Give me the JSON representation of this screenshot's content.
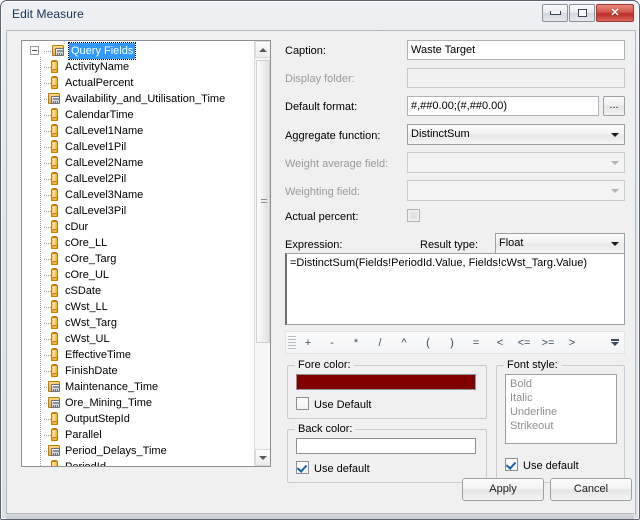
{
  "window": {
    "title": "Edit Measure",
    "controls": {
      "minimize": "minimize",
      "restore": "restore",
      "close": "✕"
    }
  },
  "tree": {
    "root": {
      "label": "Query Fields",
      "icon": "calculated-folder-icon",
      "selected": true,
      "expanded": true
    },
    "items": [
      {
        "label": "ActivityName",
        "icon": "field-icon"
      },
      {
        "label": "ActualPercent",
        "icon": "field-icon"
      },
      {
        "label": "Availability_and_Utilisation_Time",
        "icon": "calculated-folder-icon"
      },
      {
        "label": "CalendarTime",
        "icon": "field-icon"
      },
      {
        "label": "CalLevel1Name",
        "icon": "field-icon"
      },
      {
        "label": "CalLevel1Pil",
        "icon": "field-icon"
      },
      {
        "label": "CalLevel2Name",
        "icon": "field-icon"
      },
      {
        "label": "CalLevel2Pil",
        "icon": "field-icon"
      },
      {
        "label": "CalLevel3Name",
        "icon": "field-icon"
      },
      {
        "label": "CalLevel3Pil",
        "icon": "field-icon"
      },
      {
        "label": "cDur",
        "icon": "field-icon"
      },
      {
        "label": "cOre_LL",
        "icon": "field-icon"
      },
      {
        "label": "cOre_Targ",
        "icon": "field-icon"
      },
      {
        "label": "cOre_UL",
        "icon": "field-icon"
      },
      {
        "label": "cSDate",
        "icon": "field-icon"
      },
      {
        "label": "cWst_LL",
        "icon": "field-icon"
      },
      {
        "label": "cWst_Targ",
        "icon": "field-icon"
      },
      {
        "label": "cWst_UL",
        "icon": "field-icon"
      },
      {
        "label": "EffectiveTime",
        "icon": "field-icon"
      },
      {
        "label": "FinishDate",
        "icon": "field-icon"
      },
      {
        "label": "Maintenance_Time",
        "icon": "calculated-folder-icon"
      },
      {
        "label": "Ore_Mining_Time",
        "icon": "calculated-folder-icon"
      },
      {
        "label": "OutputStepId",
        "icon": "field-icon"
      },
      {
        "label": "Parallel",
        "icon": "field-icon"
      },
      {
        "label": "Period_Delays_Time",
        "icon": "calculated-folder-icon"
      },
      {
        "label": "PeriodId",
        "icon": "field-icon"
      }
    ],
    "scrollbar": {
      "up": "scroll-up-icon",
      "down": "scroll-down-icon"
    }
  },
  "form": {
    "caption": {
      "label": "Caption:",
      "value": "Waste Target",
      "placeholder": ""
    },
    "display_folder": {
      "label": "Display folder:",
      "value": "",
      "placeholder": "",
      "disabled": true
    },
    "default_format": {
      "label": "Default format:",
      "value": "#,##0.00;(#,##0.00)",
      "placeholder": "",
      "browse": "..."
    },
    "aggregate_function": {
      "label": "Aggregate function:",
      "value": "DistinctSum"
    },
    "weight_average_field": {
      "label": "Weight average field:",
      "value": "",
      "disabled": true
    },
    "weighting_field": {
      "label": "Weighting field:",
      "value": "",
      "disabled": true
    },
    "actual_percent": {
      "label": "Actual percent:",
      "checked": false,
      "disabled": true
    },
    "expression": {
      "label": "Expression:",
      "value": "=DistinctSum(Fields!PeriodId.Value, Fields!cWst_Targ.Value)"
    },
    "result_type": {
      "label": "Result type:",
      "value": "Float"
    },
    "operators": [
      "+",
      "-",
      "*",
      "/",
      "^",
      "(",
      ")",
      "=",
      "<",
      "<=",
      ">=",
      ">"
    ],
    "fore_color": {
      "caption": "Fore color:",
      "value": "#800000",
      "use_default_label": "Use Default",
      "use_default_checked": false
    },
    "back_color": {
      "caption": "Back color:",
      "value": "",
      "use_default_label": "Use default",
      "use_default_checked": true
    },
    "font_style": {
      "caption": "Font style:",
      "options": [
        "Bold",
        "Italic",
        "Underline",
        "Strikeout"
      ],
      "use_default_label": "Use default",
      "use_default_checked": true
    }
  },
  "footer": {
    "apply": "Apply",
    "cancel": "Cancel"
  }
}
